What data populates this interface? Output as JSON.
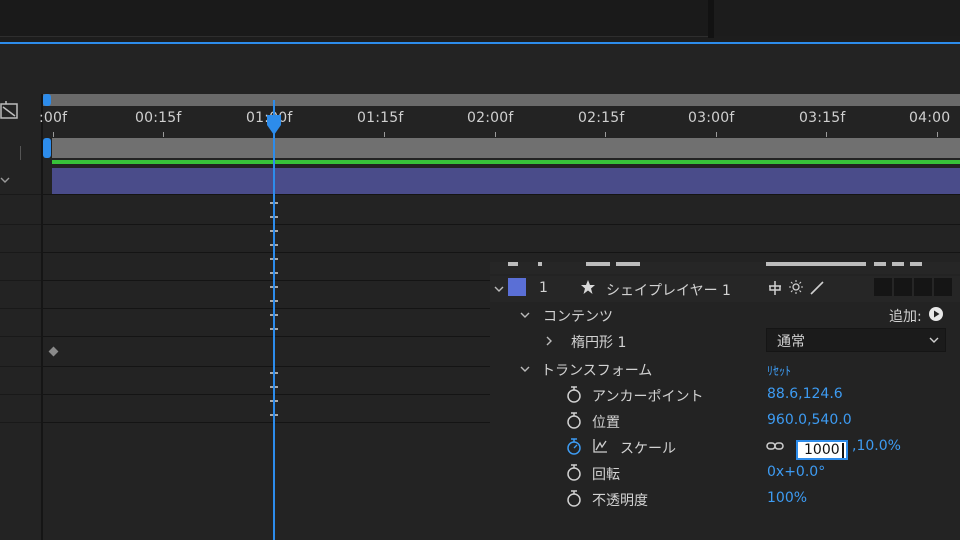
{
  "ruler": {
    "ticks": [
      ":00f",
      "00:15f",
      "01:00f",
      "01:15f",
      "02:00f",
      "02:15f",
      "03:00f",
      "03:15f",
      "04:00"
    ]
  },
  "layer": {
    "number": "1",
    "name": "シェイプレイヤー 1",
    "color": "#5a6fd6"
  },
  "contents": {
    "label": "コンテンツ",
    "add_label": "追加:",
    "ellipse_label": "楕円形 1",
    "blend_mode": "通常"
  },
  "transform": {
    "label": "トランスフォーム",
    "reset_label": "ﾘｾｯﾄ",
    "properties": [
      {
        "label": "アンカーポイント",
        "value": "88.6,124.6"
      },
      {
        "label": "位置",
        "value": "960.0,540.0"
      },
      {
        "label": "スケール",
        "input_value": "1000",
        "value_rest": ",10.0%"
      },
      {
        "label": "回転",
        "value": "0x+0.0°"
      },
      {
        "label": "不透明度",
        "value": "100%"
      }
    ]
  },
  "colors": {
    "accent": "#2d8ceb",
    "layer_bar": "#4a4c8a",
    "audio_line": "#38c23a"
  }
}
